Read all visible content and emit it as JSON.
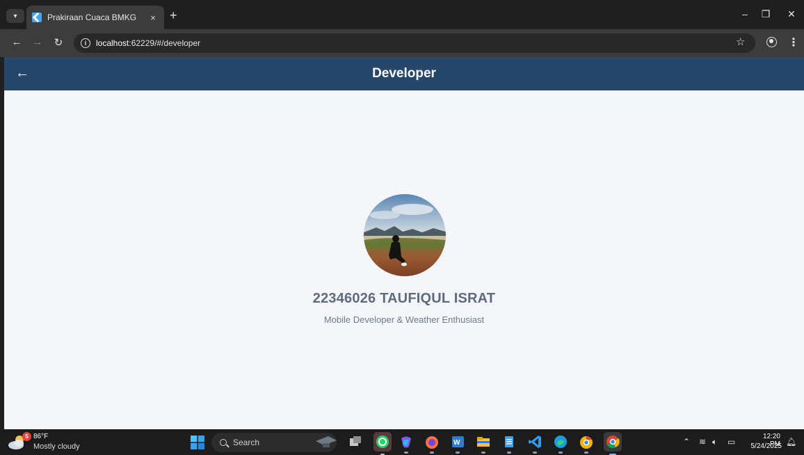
{
  "browser": {
    "tab_title": "Prakiraan Cuaca BMKG",
    "tab_close": "×",
    "new_tab": "+",
    "url_host": "localhost",
    "url_rest": ":62229/#/developer"
  },
  "app": {
    "title": "Developer",
    "developer_name": "22346026 TAUFIQUL ISRAT",
    "developer_role": "Mobile Developer & Weather Enthusiast"
  },
  "taskbar": {
    "weather_badge": "5",
    "weather_temp": "86°F",
    "weather_desc": "Mostly cloudy",
    "search_label": "Search",
    "time": "12:20 PM",
    "date": "5/24/2025"
  },
  "colors": {
    "appbar": "#27466b",
    "app_background": "#f5f6fa",
    "name_text": "#5d6b7d"
  }
}
